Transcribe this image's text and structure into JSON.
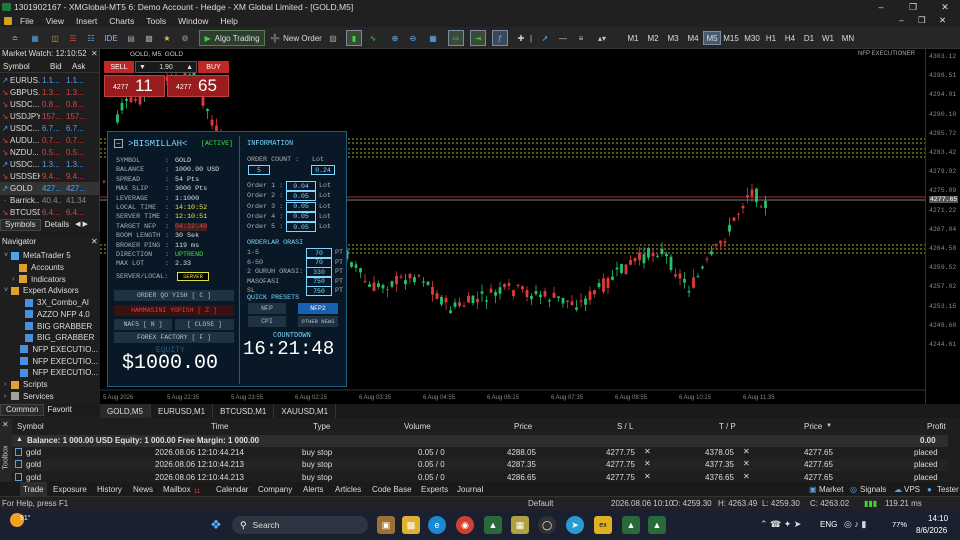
{
  "window": {
    "title": "1301902167 - XMGlobal-MT5 6: Demo Account - Hedge - XM Global Limited - [GOLD,M5]"
  },
  "menu": [
    "File",
    "View",
    "Insert",
    "Charts",
    "Tools",
    "Window",
    "Help"
  ],
  "toolbar": {
    "algo_trading": "Algo Trading",
    "new_order": "New Order",
    "timeframes": [
      "M1",
      "M2",
      "M3",
      "M4",
      "M5",
      "M15",
      "M30",
      "H1",
      "H4",
      "D1",
      "W1",
      "MN"
    ],
    "active_tf": "M5"
  },
  "market_watch": {
    "title": "Market Watch: 12:10:52",
    "headers": [
      "Symbol",
      "Bid",
      "Ask"
    ],
    "rows": [
      {
        "dir": "up",
        "sym": "EURUS...",
        "bid": "1.1...",
        "ask": "1.1..."
      },
      {
        "dir": "down",
        "sym": "GBPUS...",
        "bid": "1.3...",
        "ask": "1.3..."
      },
      {
        "dir": "down",
        "sym": "USDC...",
        "bid": "0.8...",
        "ask": "0.8..."
      },
      {
        "dir": "down",
        "sym": "USDJPY",
        "bid": "157...",
        "ask": "157..."
      },
      {
        "dir": "up",
        "sym": "USDC...",
        "bid": "6.7...",
        "ask": "6.7..."
      },
      {
        "dir": "down",
        "sym": "AUDU...",
        "bid": "0.7...",
        "ask": "0.7..."
      },
      {
        "dir": "down",
        "sym": "NZDU...",
        "bid": "0.5...",
        "ask": "0.5..."
      },
      {
        "dir": "up",
        "sym": "USDC...",
        "bid": "1.3...",
        "ask": "1.3..."
      },
      {
        "dir": "down",
        "sym": "USDSEK",
        "bid": "9.4...",
        "ask": "9.4..."
      },
      {
        "dir": "up",
        "sym": "GOLD",
        "bid": "427...",
        "ask": "427..."
      },
      {
        "dir": "none",
        "sym": "Barrick...",
        "bid": "40.4...",
        "ask": "41.34"
      },
      {
        "dir": "down",
        "sym": "BTCUSD",
        "bid": "6.4...",
        "ask": "6.4..."
      }
    ],
    "tabs": [
      "Symbols",
      "Details"
    ]
  },
  "navigator": {
    "title": "Navigator",
    "items": [
      "MetaTrader 5",
      "Accounts",
      "Indicators",
      "Expert Advisors",
      "3X_Combo_AI",
      "AZZO NFP 4.0",
      "BIG GRABBER",
      "BIG_GRABBER",
      "NFP EXECUTIO...",
      "NFP EXECUTIO...",
      "NFP EXECUTIO...",
      "Scripts",
      "Services"
    ],
    "tabs": [
      "Common",
      "Favorites"
    ]
  },
  "chart": {
    "symbol_label": "GOLD, M5: GOLD",
    "ea_label": "NFP EXECUTIONER",
    "price_ticks": [
      "4303.12",
      "4298.51",
      "4294.01",
      "4290.10",
      "4285.72",
      "4283.42",
      "4279.92",
      "4277.65",
      "4275.09",
      "4271.22",
      "4267.04",
      "4264.58",
      "4259.52",
      "4257.02",
      "4253.15",
      "4248.60",
      "4244.61"
    ],
    "current_price": "4277.65",
    "time_ticks": [
      "5 Aug 2026",
      "5 Aug 22:35",
      "5 Aug 23:55",
      "6 Aug 02:15",
      "6 Aug 03:35",
      "6 Aug 04:55",
      "6 Aug 06:15",
      "6 Aug 07:35",
      "6 Aug 08:55",
      "6 Aug 10:15",
      "6 Aug 11:35"
    ],
    "tabs": [
      "GOLD,M5",
      "EURUSD,M1",
      "BTCUSD,M1",
      "XAUUSD,M1"
    ]
  },
  "trade_panel": {
    "sell": "SELL",
    "buy": "BUY",
    "lot": "1.90",
    "sell_small": "4277",
    "sell_big": "11",
    "buy_small": "4277",
    "buy_big": "65"
  },
  "ea": {
    "title": ">BISMILLAH<",
    "status": "[ACTIVE]",
    "info_title": "INFORMATION",
    "fields": [
      {
        "k": "SYMBOL",
        "v": "GOLD"
      },
      {
        "k": "BALANCE",
        "v": "1000.00 USD"
      },
      {
        "k": "SPREAD",
        "v": "54 Pts"
      },
      {
        "k": "MAX SLIP",
        "v": "3000 Pts"
      },
      {
        "k": "LEVERAGE",
        "v": "1:1000"
      },
      {
        "k": "LOCAL TIME",
        "v": "14:10:52"
      },
      {
        "k": "SERVER TIME",
        "v": "12:10:51"
      },
      {
        "k": "TARGET NFP",
        "v": "04:32:40"
      },
      {
        "k": "BOOM LENGTH",
        "v": "30 Sek"
      },
      {
        "k": "BROKER PING",
        "v": "119 ms"
      },
      {
        "k": "DIRECTION",
        "v": "UPTREND"
      },
      {
        "k": "MAX LOT",
        "v": "2.33"
      }
    ],
    "server_local_label": "SERVER/LOCAL:",
    "server_btn": "SERVER",
    "btn_order": "ORDER QO`YISH [ C ]",
    "btn_close_all": "HAMMASINI YOPISH [ Z ]",
    "btn_nafs": "NAFS [ N ]",
    "btn_close": "[ CLOSE ]",
    "btn_forex": "FOREX FACTORY [ F ]",
    "equity_label": "EQUITY",
    "equity_value": "$1000.00",
    "order_count_label": "ORDER COUNT :",
    "lot_label": "Lot",
    "order_count": "5",
    "total_lot": "0.24",
    "orders": [
      {
        "k": "Order 1 :",
        "v": "0.04"
      },
      {
        "k": "Order 2 :",
        "v": "0.05"
      },
      {
        "k": "Order 3 :",
        "v": "0.05"
      },
      {
        "k": "Order 4 :",
        "v": "0.05"
      },
      {
        "k": "Order 5 :",
        "v": "0.05"
      }
    ],
    "lot_unit": "Lot",
    "gap_title": "ORDERLAR ORASI",
    "gaps": [
      {
        "k": "1-5",
        "v": "70"
      },
      {
        "k": "6-50",
        "v": "70"
      },
      {
        "k": "2 GURUH ORASI:",
        "v": "330"
      },
      {
        "k": "MASOFASI",
        "v": "750"
      },
      {
        "k": "SL",
        "v": "750"
      }
    ],
    "pt_unit": "PT",
    "presets_title": "QUICK PRESETS",
    "presets": [
      "NFP",
      "NFP2",
      "CPI",
      "OTHER NEWS"
    ],
    "countdown_label": "COUNTDOWN",
    "countdown": "16:21:48"
  },
  "terminal": {
    "headers": [
      "Symbol",
      "Time",
      "Type",
      "Volume",
      "Price",
      "S / L",
      "T / P",
      "Price",
      "Profit"
    ],
    "balance_line": "Balance: 1 000.00 USD  Equity: 1 000.00  Free Margin: 1 000.00",
    "balance_profit": "0.00",
    "orders": [
      {
        "symbol": "gold",
        "time": "2026.08.06 12:10:44.214",
        "type": "buy stop",
        "volume": "0.05 / 0",
        "price": "4288.05",
        "sl": "4277.75",
        "tp": "4378.05",
        "cur": "4277.65",
        "status": "placed"
      },
      {
        "symbol": "gold",
        "time": "2026.08.06 12:10:44.213",
        "type": "buy stop",
        "volume": "0.05 / 0",
        "price": "4287.35",
        "sl": "4277.75",
        "tp": "4377.35",
        "cur": "4277.65",
        "status": "placed"
      },
      {
        "symbol": "gold",
        "time": "2026.08.06 12:10:44.213",
        "type": "buy stop",
        "volume": "0.05 / 0",
        "price": "4286.65",
        "sl": "4277.75",
        "tp": "4376.65",
        "cur": "4277.65",
        "status": "placed"
      }
    ],
    "tabs": [
      "Trade",
      "Exposure",
      "History",
      "News",
      "Mailbox",
      "Calendar",
      "Company",
      "Alerts",
      "Articles",
      "Code Base",
      "Experts",
      "Journal"
    ],
    "mailbox_badge": "11",
    "right_tabs": [
      "Market",
      "Signals",
      "VPS",
      "Tester"
    ],
    "toolbox_label": "Toolbox"
  },
  "status": {
    "help": "For Help, press F1",
    "profile": "Default",
    "datetime": "2026.08.06 10:10",
    "open": "O: 4259.30",
    "high": "H: 4263.49",
    "low": "L: 4259.30",
    "close": "C: 4263.02",
    "ping": "119.21 ms"
  },
  "taskbar": {
    "weather": "91°",
    "search": "Search",
    "lang": "ENG",
    "battery": "77%",
    "time": "14:10",
    "date": "8/6/2026"
  }
}
